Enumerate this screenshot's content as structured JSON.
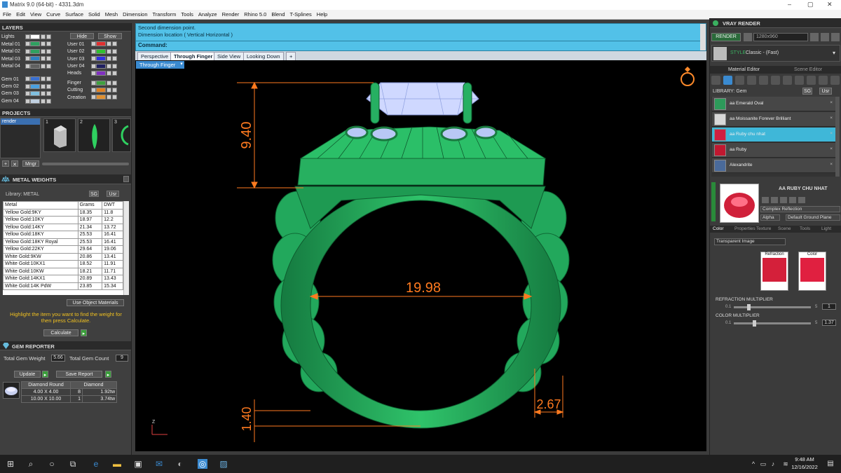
{
  "window": {
    "title": "Matrix 9.0 (64-bit) - 4331.3dm",
    "controls": [
      "–",
      "▢",
      "✕"
    ]
  },
  "menu": [
    "File",
    "Edit",
    "View",
    "Curve",
    "Surface",
    "Solid",
    "Mesh",
    "Dimension",
    "Transform",
    "Tools",
    "Analyze",
    "Render",
    "Rhino 5.0",
    "Blend",
    "T-Splines",
    "Help"
  ],
  "layers": {
    "title": "LAYERS",
    "hide": "Hide",
    "show": "Show",
    "left": [
      {
        "name": "Lights",
        "color": "#ffffff"
      },
      {
        "name": "Metal 01",
        "color": "#2fa060"
      },
      {
        "name": "Metal 02",
        "color": "#2fa060"
      },
      {
        "name": "Metal 03",
        "color": "#2f80c0"
      },
      {
        "name": "Metal 04",
        "color": "#606060"
      },
      {
        "name": "Gem 01",
        "color": "#3a6fd0"
      },
      {
        "name": "Gem 02",
        "color": "#4aa0e0"
      },
      {
        "name": "Gem 03",
        "color": "#80c0e0"
      },
      {
        "name": "Gem 04",
        "color": "#c0d0e0"
      }
    ],
    "right": [
      {
        "name": "User 01",
        "color": "#e03030"
      },
      {
        "name": "User 02",
        "color": "#30c030"
      },
      {
        "name": "User 03",
        "color": "#3030e0"
      },
      {
        "name": "User 04",
        "color": "#202060"
      },
      {
        "name": "Heads",
        "color": "#8030c0"
      },
      {
        "name": "Finger",
        "color": "#40a040"
      },
      {
        "name": "Cutting",
        "color": "#e08020"
      },
      {
        "name": "Creation",
        "color": "#e09030"
      }
    ]
  },
  "projects": {
    "title": "PROJECTS",
    "item": "render",
    "thumbs": [
      "1",
      "2",
      "3"
    ],
    "buttons": [
      "+",
      "✕",
      "Mngr"
    ]
  },
  "metal": {
    "title": "METAL WEIGHTS",
    "library": "Library: METAL",
    "sg": "SG",
    "usr": "Usr",
    "headers": [
      "Metal",
      "Grams",
      "DWT"
    ],
    "rows": [
      [
        "Yellow Gold:9KY",
        "18.35",
        "11.8"
      ],
      [
        "Yellow Gold:10KY",
        "18.97",
        "12.2"
      ],
      [
        "Yellow Gold:14KY",
        "21.34",
        "13.72"
      ],
      [
        "Yellow Gold:18KY",
        "25.53",
        "16.41"
      ],
      [
        "Yellow Gold:18KY Royal",
        "25.53",
        "16.41"
      ],
      [
        "Yellow Gold:22KY",
        "29.64",
        "19.06"
      ],
      [
        "White Gold:9KW",
        "20.86",
        "13.41"
      ],
      [
        "White Gold:10KX1",
        "18.52",
        "11.91"
      ],
      [
        "White Gold:10KW",
        "18.21",
        "11.71"
      ],
      [
        "White Gold:14KX1",
        "20.89",
        "13.43"
      ],
      [
        "White Gold:14K PdW",
        "23.85",
        "15.34"
      ]
    ],
    "use_obj": "Use Object Materials",
    "hint": "Highlight the item you want to find the weight for then press Calculate.",
    "calculate": "Calculate"
  },
  "gem": {
    "title": "GEM REPORTER",
    "total_weight_label": "Total Gem Weight",
    "total_weight": "5.66",
    "total_count_label": "Total Gem Count",
    "total_count": "9",
    "update": "Update",
    "save": "Save Report",
    "headers": [
      "Diamond Round",
      "Diamond"
    ],
    "rows": [
      [
        "4.00 X 4.00",
        "8",
        "1.92tw"
      ],
      [
        "10.00 X 10.00",
        "1",
        "3.74tw"
      ]
    ]
  },
  "command": {
    "line1": "Second dimension point.",
    "line2": "Dimension location ( Vertical  Horizontal )",
    "prompt": "Command:"
  },
  "views": {
    "tabs": [
      "Perspective",
      "Through Finger",
      "Side View",
      "Looking Down",
      "+"
    ],
    "active": "Through Finger"
  },
  "dims": {
    "top": "9.40",
    "width": "19.98",
    "bottom": "1.40",
    "side": "2.67"
  },
  "axis": {
    "label": "Z"
  },
  "vray": {
    "title": "VRAY RENDER",
    "render": "RENDER",
    "res": "1280x960",
    "style_label": "STYLE",
    "style": "Classic - (Fast)",
    "tabs": [
      "Material Editor",
      "Scene Editor"
    ],
    "library": "LIBRARY: Gem",
    "sg": "SG",
    "usr": "Usr",
    "gems": [
      {
        "name": "aa Emerald Oval",
        "color": "#2d9a5a"
      },
      {
        "name": "aa Moissanite Forever Brilliant",
        "color": "#d8d8d8"
      },
      {
        "name": "aa Ruby chu nhat",
        "color": "#d02040"
      },
      {
        "name": "aa Ruby",
        "color": "#c01830"
      },
      {
        "name": "Alexandrite",
        "color": "#4a6a9a"
      }
    ],
    "selected": "AA RUBY CHU NHAT",
    "complex": "Complex Reflection",
    "alpha": "Alpha",
    "ground": "Default Ground Plane",
    "subtabs": [
      "Color",
      "Properties",
      "Texture",
      "Scene",
      "Tools",
      "Light"
    ],
    "trans": "Transparent Image",
    "refraction": "Refraction",
    "color": "Color",
    "rmult": "REFRACTION MULTIPLIER",
    "rmin": "0.1",
    "rmax": "5",
    "rval": "1",
    "cmult": "COLOR MULTIPLIER",
    "cmin": "0.1",
    "cmax": "5",
    "cval": "1.37"
  },
  "taskbar": {
    "time": "9:48 AM",
    "date": "12/16/2022"
  },
  "colors": {
    "ring": "#1fa35a",
    "dim": "#ff7a1f",
    "cmd": "#52c1e8"
  }
}
